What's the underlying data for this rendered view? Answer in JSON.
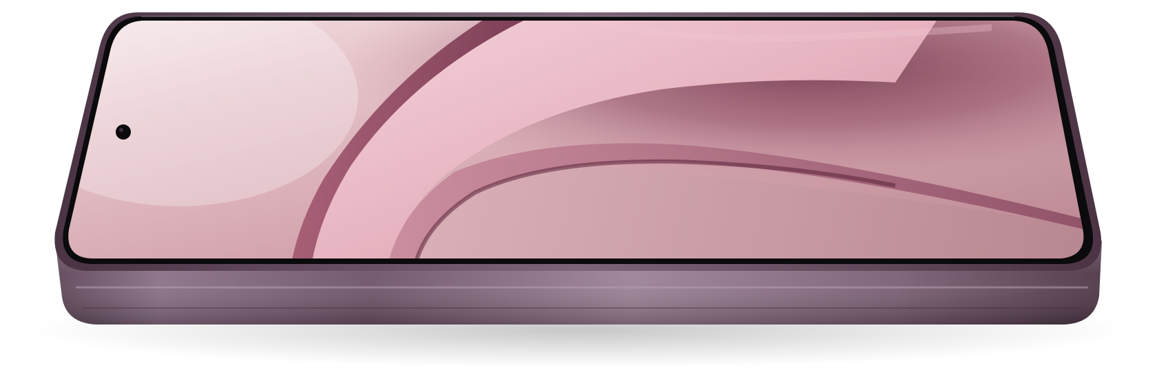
{
  "product": {
    "screen_tint": "#d8aab3",
    "frame_color": "#6f5365",
    "bezel_color": "#0b0a0c",
    "accent_ribbon": "#ecbcc8",
    "shadow_ribbon": "#6a2f45"
  }
}
